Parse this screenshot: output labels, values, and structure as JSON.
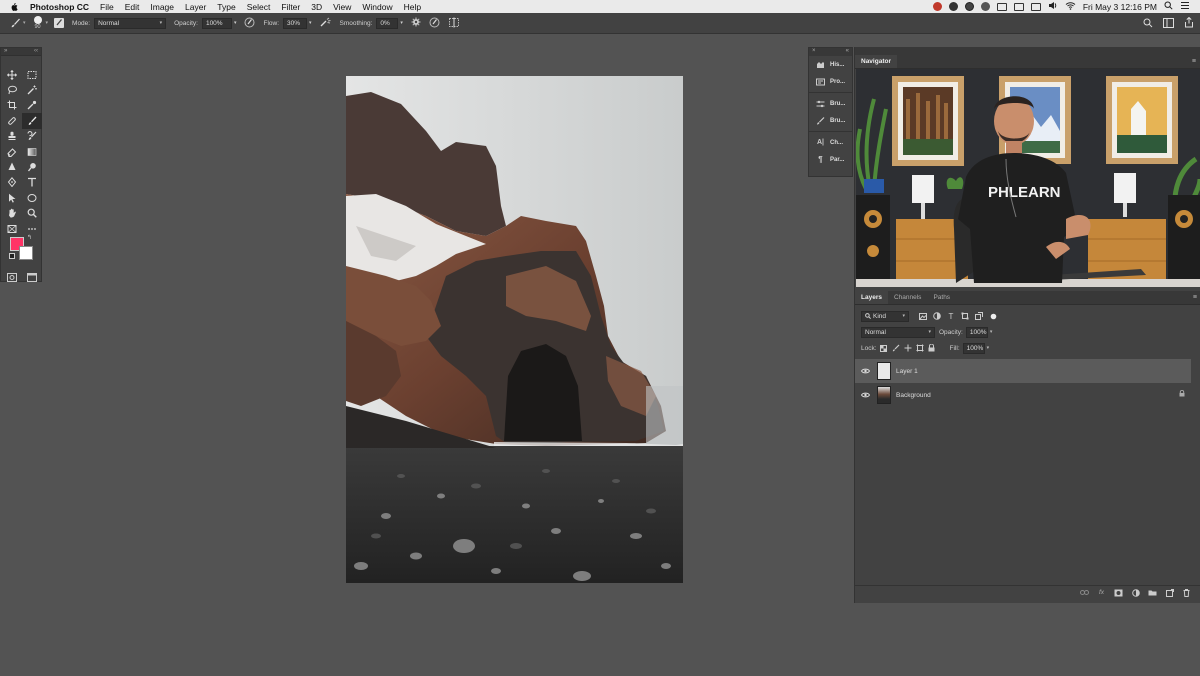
{
  "menubar": {
    "app_name": "Photoshop CC",
    "items": [
      "File",
      "Edit",
      "Image",
      "Layer",
      "Type",
      "Select",
      "Filter",
      "3D",
      "View",
      "Window",
      "Help"
    ],
    "clock": "Fri May 3  12:16 PM"
  },
  "options": {
    "brush_size": "90",
    "mode_label": "Mode:",
    "mode_value": "Normal",
    "opacity_label": "Opacity:",
    "opacity_value": "100%",
    "flow_label": "Flow:",
    "flow_value": "30%",
    "smoothing_label": "Smoothing:",
    "smoothing_value": "0%"
  },
  "colors": {
    "foreground": "#ff3366",
    "background": "#ffffff"
  },
  "dock": {
    "items": [
      "His...",
      "Pro...",
      "Bru...",
      "Bru...",
      "Ch...",
      "Par..."
    ]
  },
  "navigator": {
    "tab": "Navigator",
    "shirt_text": "PHLEARN"
  },
  "layers_panel": {
    "tabs": [
      "Layers",
      "Channels",
      "Paths"
    ],
    "filter_value": "Kind",
    "blend_value": "Normal",
    "opacity_label": "Opacity:",
    "opacity_value": "100%",
    "lock_label": "Lock:",
    "fill_label": "Fill:",
    "fill_value": "100%",
    "layers": [
      {
        "name": "Layer 1"
      },
      {
        "name": "Background"
      }
    ]
  }
}
